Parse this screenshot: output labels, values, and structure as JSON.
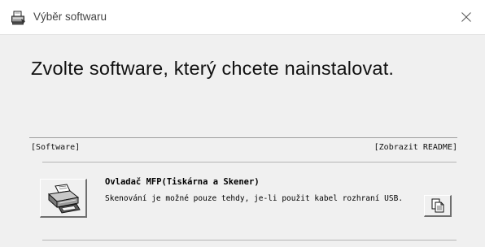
{
  "window": {
    "title": "Výběr softwaru"
  },
  "heading": "Zvolte software, který chcete nainstalovat.",
  "section": {
    "left_label": "[Software]",
    "right_label": "[Zobrazit README]"
  },
  "software_items": [
    {
      "name": "Ovladač MFP(Tiskárna a Skener)",
      "description": "Skenování je možné pouze tehdy, je-li použit kabel rozhraní USB.",
      "icon": "printer-scanner-icon",
      "readme_icon": "documents-icon"
    }
  ],
  "colors": {
    "window_bg": "#f0f0f0",
    "titlebar_bg": "#ffffff",
    "separator": "#9e9e9e"
  }
}
